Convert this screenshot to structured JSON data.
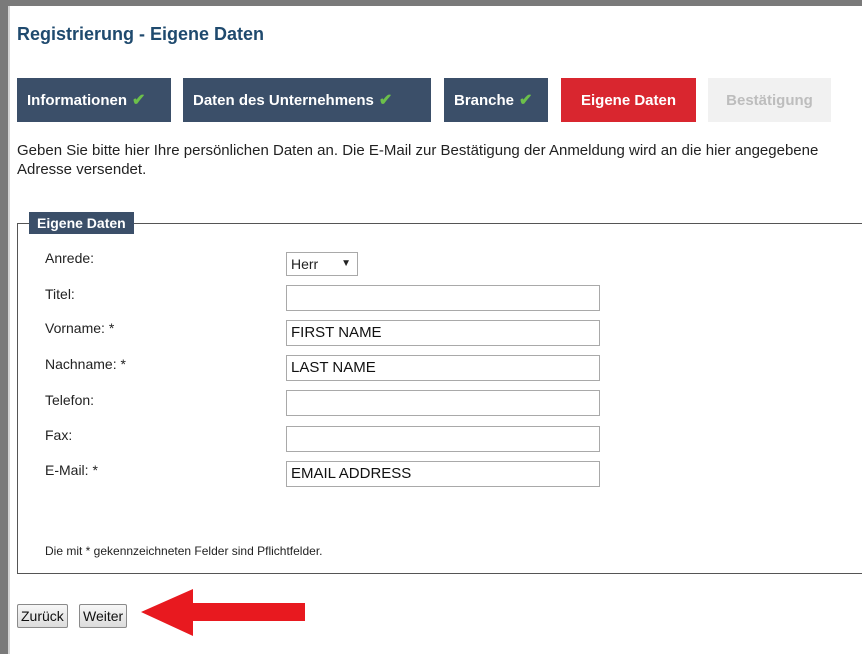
{
  "page": {
    "title": "Registrierung - Eigene Daten"
  },
  "steps": [
    {
      "label": "Informationen",
      "state": "done"
    },
    {
      "label": "Daten des Unternehmens",
      "state": "done"
    },
    {
      "label": "Branche",
      "state": "done"
    },
    {
      "label": "Eigene Daten",
      "state": "current"
    },
    {
      "label": "Bestätigung",
      "state": "upcoming"
    }
  ],
  "icons": {
    "step_done": "checkmark-icon",
    "salutation_select": "triangle-down-icon",
    "annotation": "red-arrow-icon"
  },
  "colors": {
    "title": "#1f4a6e",
    "step_done": "#3b4f69",
    "step_current": "#d9262f",
    "check": "#6cc04a",
    "arrow": "#e8191f"
  },
  "intro": "Geben Sie bitte hier Ihre persönlichen Daten an. Die E-Mail zur Bestätigung der Anmeldung wird an die hier angegebene Adresse versendet.",
  "form": {
    "legend": "Eigene Daten",
    "fields": {
      "anrede": {
        "label": "Anrede:",
        "value": "Herr"
      },
      "titel": {
        "label": "Titel:",
        "value": ""
      },
      "vorname": {
        "label": "Vorname: *",
        "value": "FIRST NAME"
      },
      "nachname": {
        "label": "Nachname: *",
        "value": "LAST NAME"
      },
      "telefon": {
        "label": "Telefon:",
        "value": ""
      },
      "fax": {
        "label": "Fax:",
        "value": ""
      },
      "email": {
        "label": "E-Mail: *",
        "value": "EMAIL ADDRESS"
      }
    },
    "footnote": "Die mit * gekennzeichneten Felder sind Pflichtfelder."
  },
  "buttons": {
    "back": "Zurück",
    "next": "Weiter"
  }
}
